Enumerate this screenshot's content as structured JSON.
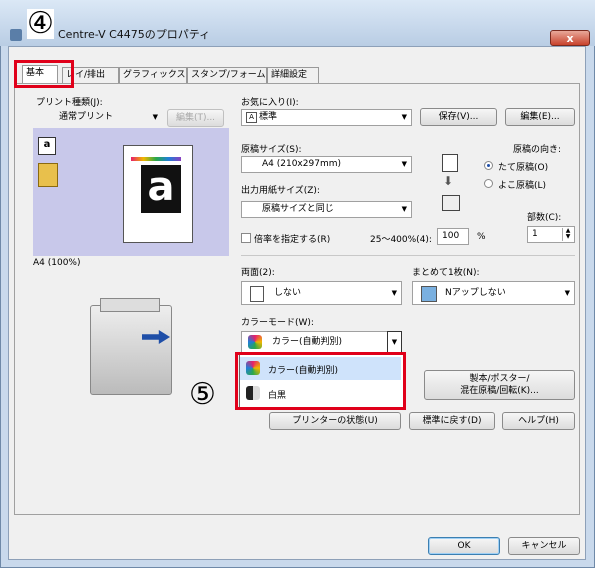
{
  "window": {
    "title": "Centre-V C4475のプロパティ",
    "close_label": "x"
  },
  "tabs": [
    {
      "label": "基本"
    },
    {
      "label": "レイ/排出"
    },
    {
      "label": "グラフィックス"
    },
    {
      "label": "スタンプ/フォーム"
    },
    {
      "label": "詳細設定"
    }
  ],
  "annotations": {
    "step4": "④",
    "step5": "⑤"
  },
  "print_type": {
    "label": "プリント種類(J):",
    "value": "通常プリント",
    "edit_button": "編集(T)..."
  },
  "favorites": {
    "label": "お気に入り(I):",
    "value": "標準",
    "save_button": "保存(V)...",
    "edit_button": "編集(E)..."
  },
  "preview": {
    "caption": "A4 (100%)"
  },
  "original_size": {
    "label": "原稿サイズ(S):",
    "value": "A4 (210x297mm)"
  },
  "output_size": {
    "label": "出力用紙サイズ(Z):",
    "value": "原稿サイズと同じ"
  },
  "orientation": {
    "label": "原稿の向き:",
    "portrait": "たて原稿(O)",
    "landscape": "よこ原稿(L)",
    "selected": "portrait"
  },
  "scale": {
    "label": "倍率を指定する(R)",
    "range": "25～400%(4):",
    "value": "100",
    "unit": "%",
    "checked": false
  },
  "copies": {
    "label": "部数(C):",
    "value": "1"
  },
  "duplex": {
    "label": "両面(2):",
    "value": "しない"
  },
  "nup": {
    "label": "まとめて1枚(N):",
    "value": "Nアップしない"
  },
  "color_mode": {
    "label": "カラーモード(W):",
    "value": "カラー(自動判別)",
    "options": [
      "カラー(自動判別)",
      "白黒"
    ],
    "highlighted": 0
  },
  "booklet_button": {
    "line1": "製本/ポスター/",
    "line2": "混在原稿/回転(K)..."
  },
  "bottom_buttons": {
    "printer_status": "プリンターの状態(U)",
    "reset": "標準に戻す(D)",
    "help": "ヘルプ(H)"
  },
  "dialog_buttons": {
    "ok": "OK",
    "cancel": "キャンセル"
  },
  "colors": {
    "highlight": "#cfe3fb",
    "annotation_red": "#e0001a"
  }
}
